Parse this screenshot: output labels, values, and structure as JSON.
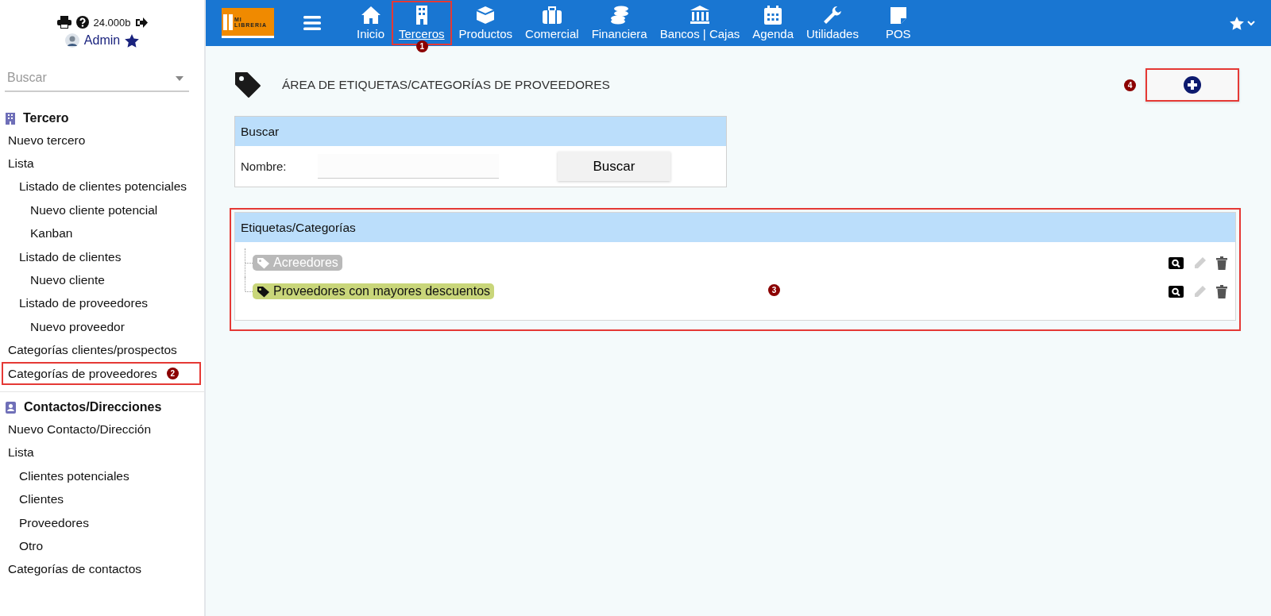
{
  "user_box": {
    "credit": "24.000b",
    "user": "Admin"
  },
  "sidebar": {
    "search": {
      "placeholder": "Buscar"
    },
    "sections": [
      {
        "title": "Tercero",
        "items": [
          {
            "label": "Nuevo tercero"
          },
          {
            "label": "Lista",
            "children": [
              {
                "label": "Listado de clientes potenciales",
                "children": [
                  {
                    "label": "Nuevo cliente potencial"
                  },
                  {
                    "label": "Kanban"
                  }
                ]
              },
              {
                "label": "Listado de clientes",
                "children": [
                  {
                    "label": "Nuevo cliente"
                  }
                ]
              },
              {
                "label": "Listado de proveedores",
                "children": [
                  {
                    "label": "Nuevo proveedor"
                  }
                ]
              }
            ]
          },
          {
            "label": "Categorías clientes/prospectos"
          },
          {
            "label": "Categorías de proveedores",
            "marker": "2"
          }
        ]
      },
      {
        "title": "Contactos/Direcciones",
        "items": [
          {
            "label": "Nuevo Contacto/Dirección"
          },
          {
            "label": "Lista",
            "children": [
              {
                "label": "Clientes potenciales"
              },
              {
                "label": "Clientes"
              },
              {
                "label": "Proveedores"
              },
              {
                "label": "Otro"
              }
            ]
          },
          {
            "label": "Categorías de contactos"
          }
        ]
      }
    ]
  },
  "topbar": {
    "logo": {
      "line1": "MI",
      "line2": "LIBRERIA"
    },
    "nav": [
      {
        "label": "Inicio",
        "selected": false
      },
      {
        "label": "Terceros",
        "selected": true,
        "marker": "1"
      },
      {
        "label": "Productos",
        "selected": false
      },
      {
        "label": "Comercial",
        "selected": false
      },
      {
        "label": "Financiera",
        "selected": false
      },
      {
        "label": "Bancos | Cajas",
        "selected": false
      },
      {
        "label": "Agenda",
        "selected": false
      },
      {
        "label": "Utilidades",
        "selected": false
      },
      {
        "label": "POS",
        "selected": false
      }
    ]
  },
  "page": {
    "title": "ÁREA DE ETIQUETAS/CATEGORÍAS DE PROVEEDORES",
    "add_marker": "4",
    "search_panel": {
      "title": "Buscar",
      "field_label": "Nombre:",
      "button": "Buscar"
    },
    "categories_panel": {
      "title": "Etiquetas/Categorías",
      "marker": "3",
      "tags": [
        {
          "label": "Acreedores",
          "color": "#b9b9b9"
        },
        {
          "label": "Proveedores con mayores descuentos",
          "color": "#c9d67a"
        }
      ]
    }
  }
}
